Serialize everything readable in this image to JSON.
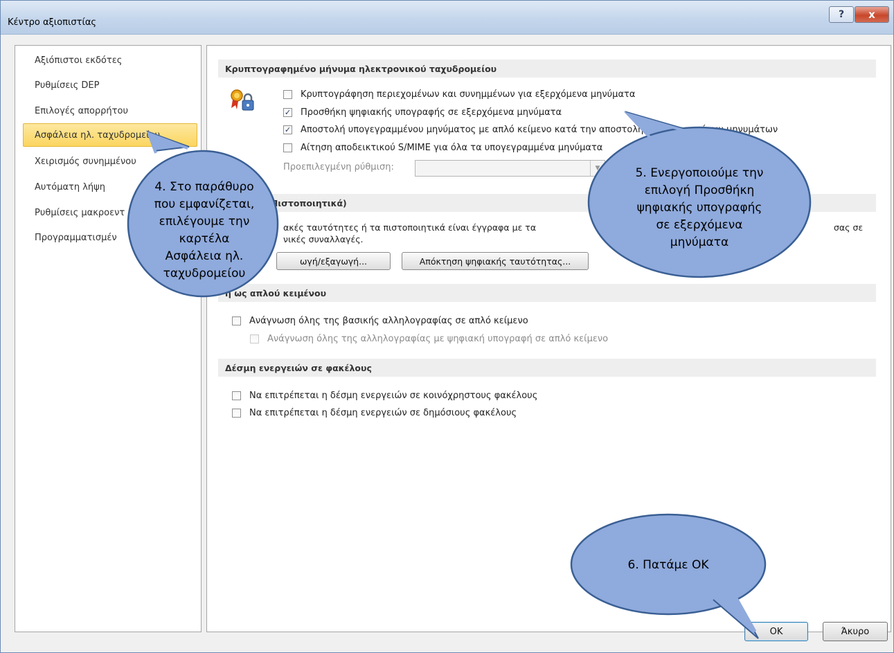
{
  "window": {
    "title": "Κέντρο αξιοπιστίας",
    "help_label": "?",
    "close_label": "x"
  },
  "sidebar": {
    "items": [
      {
        "label": "Αξιόπιστοι εκδότες"
      },
      {
        "label": "Ρυθμίσεις DEP"
      },
      {
        "label": "Επιλογές απορρήτου"
      },
      {
        "label": "Ασφάλεια ηλ. ταχυδρομείου",
        "active": true
      },
      {
        "label": "Χειρισμός συνημμένου"
      },
      {
        "label": "Αυτόματη λήψη"
      },
      {
        "label": "Ρυθμίσεις μακροεντ"
      },
      {
        "label": "Προγραμματισμέν"
      }
    ]
  },
  "sections": {
    "encrypted": {
      "header": "Κρυπτογραφημένο μήνυμα ηλεκτρονικού ταχυδρομείου",
      "options": [
        {
          "label": "Κρυπτογράφηση περιεχομένων και συνημμένων για εξερχόμενα μηνύματα",
          "checked": false
        },
        {
          "label": "Προσθήκη ψηφιακής υπογραφής σε εξερχόμενα μηνύματα",
          "checked": true
        },
        {
          "label": "Αποστολή υπογεγραμμένου μηνύματος με απλό κείμενο κατά την αποστολή υπογεγραμμένων μηνυμάτων",
          "checked": true
        },
        {
          "label": "Αίτηση αποδεικτικού S/MIME για όλα τα υπογεγραμμένα μηνύματα",
          "checked": false
        }
      ],
      "default_setting_label": "Προεπιλεγμένη ρύθμιση:",
      "default_setting_value": ""
    },
    "digital_ids": {
      "header": "τότητες (Πιστοποιητικά)",
      "description_line1": "ακές ταυτότητες ή τα πιστοποιητικά είναι έγγραφα με τα",
      "description_line1_end": "σας σε",
      "description_line2": "νικές συναλλαγές.",
      "import_export_label": "ωγή/εξαγωγή...",
      "get_id_label": "Απόκτηση ψηφιακής ταυτότητας..."
    },
    "plain_text": {
      "header": "η ως απλού κειμένου",
      "options": [
        {
          "label": "Ανάγνωση όλης της βασικής αλληλογραφίας σε απλό κείμενο",
          "checked": false,
          "disabled": false
        },
        {
          "label": "Ανάγνωση όλης της αλληλογραφίας με ψηφιακή υπογραφή σε απλό κείμενο",
          "checked": false,
          "disabled": true
        }
      ]
    },
    "folder_script": {
      "header": "Δέσμη ενεργειών σε φακέλους",
      "options": [
        {
          "label": "Να επιτρέπεται η δέσμη ενεργειών σε κοινόχρηστους φακέλους",
          "checked": false
        },
        {
          "label": "Να επιτρέπεται η δέσμη ενεργειών σε δημόσιους φακέλους",
          "checked": false
        }
      ]
    }
  },
  "callouts": {
    "step4": "4. Στο παράθυρο που εμφανίζεται, επιλέγουμε την καρτέλα Ασφάλεια ηλ. ταχυδρομείου",
    "step5": "5. Ενεργοποιούμε την επιλογή Προσθήκη ψηφιακής υπογραφής σε εξερχόμενα μηνύματα",
    "step6": "6. Πατάμε OK"
  },
  "footer": {
    "ok_label": "OK",
    "cancel_label": "Άκυρο"
  },
  "colors": {
    "callout_fill": "#8faadc",
    "callout_stroke": "#3a5f94",
    "active_tab": "#fbd55f"
  }
}
